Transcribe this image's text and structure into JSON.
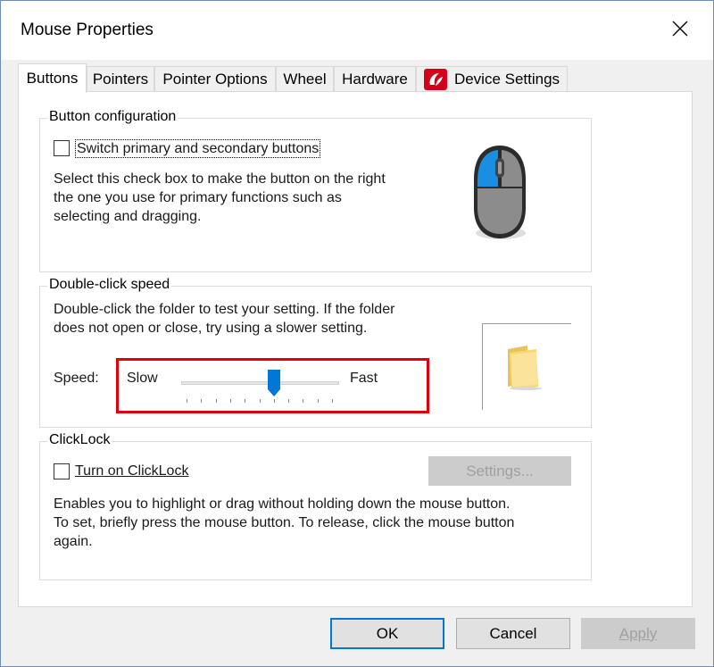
{
  "window": {
    "title": "Mouse Properties"
  },
  "tabs": [
    {
      "label": "Buttons",
      "active": true
    },
    {
      "label": "Pointers"
    },
    {
      "label": "Pointer Options"
    },
    {
      "label": "Wheel"
    },
    {
      "label": "Hardware"
    },
    {
      "label": "Device Settings",
      "icon": "device-settings-icon"
    }
  ],
  "button_configuration": {
    "title": "Button configuration",
    "checkbox_label": "Switch primary and secondary buttons",
    "checked": false,
    "description": [
      "Select this check box to make the button on the right",
      "the one you use for primary functions such as",
      "selecting and dragging."
    ],
    "image": "mouse-icon"
  },
  "double_click": {
    "title": "Double-click speed",
    "description": [
      "Double-click the folder to test your setting. If the folder",
      "does not open or close, try using a slower setting."
    ],
    "speed_label": "Speed:",
    "slow_label": "Slow",
    "fast_label": "Fast",
    "slider_value": 0.6,
    "tick_count": 11,
    "test_icon": "folder-icon",
    "highlight_color": "#e0000b"
  },
  "clicklock": {
    "title": "ClickLock",
    "checkbox_label": "Turn on ClickLock",
    "checked": false,
    "settings_button": "Settings...",
    "description": [
      "Enables you to highlight or drag without holding down the mouse button.",
      "To set, briefly press the mouse button. To release, click the mouse button",
      "again."
    ]
  },
  "footer": {
    "ok": "OK",
    "cancel": "Cancel",
    "apply": "Apply"
  },
  "colors": {
    "accent": "#0078d7",
    "highlight": "#e0000b"
  }
}
